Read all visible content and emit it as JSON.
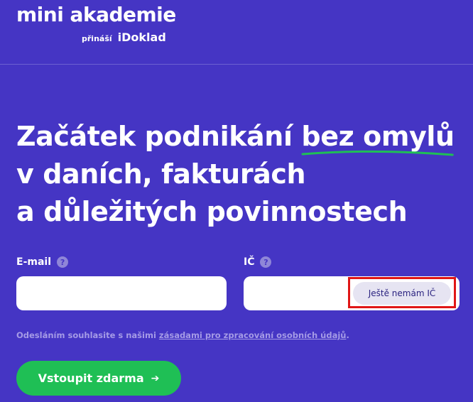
{
  "header": {
    "logo_text": "mini akademie",
    "tagline": "přináší",
    "brand": "iDoklad"
  },
  "hero": {
    "line1_start": "Začátek podnikání ",
    "line1_highlight": "bez omylů",
    "line2": "v daních, fakturách",
    "line3": "a důležitých povinnostech",
    "underline_color": "#1fbf55"
  },
  "form": {
    "email": {
      "label": "E-mail",
      "help_icon": "question-circle-icon",
      "help_glyph": "?",
      "value": ""
    },
    "ic": {
      "label": "IČ",
      "help_icon": "question-circle-icon",
      "help_glyph": "?",
      "value": "",
      "no_ic_button_label": "Ještě nemám IČ"
    },
    "consent_prefix": "Odesláním souhlasite s našimi ",
    "consent_link": "zásadami pro zpracování osobních údajů",
    "consent_suffix": ".",
    "submit_label": "Vstoupit zdarma",
    "submit_icon": "arrow-right-icon",
    "submit_glyph": "➔"
  },
  "colors": {
    "background": "#4535c4",
    "submit": "#1fbf55",
    "highlight_box": "#e01616",
    "muted_text": "#a59be6"
  }
}
